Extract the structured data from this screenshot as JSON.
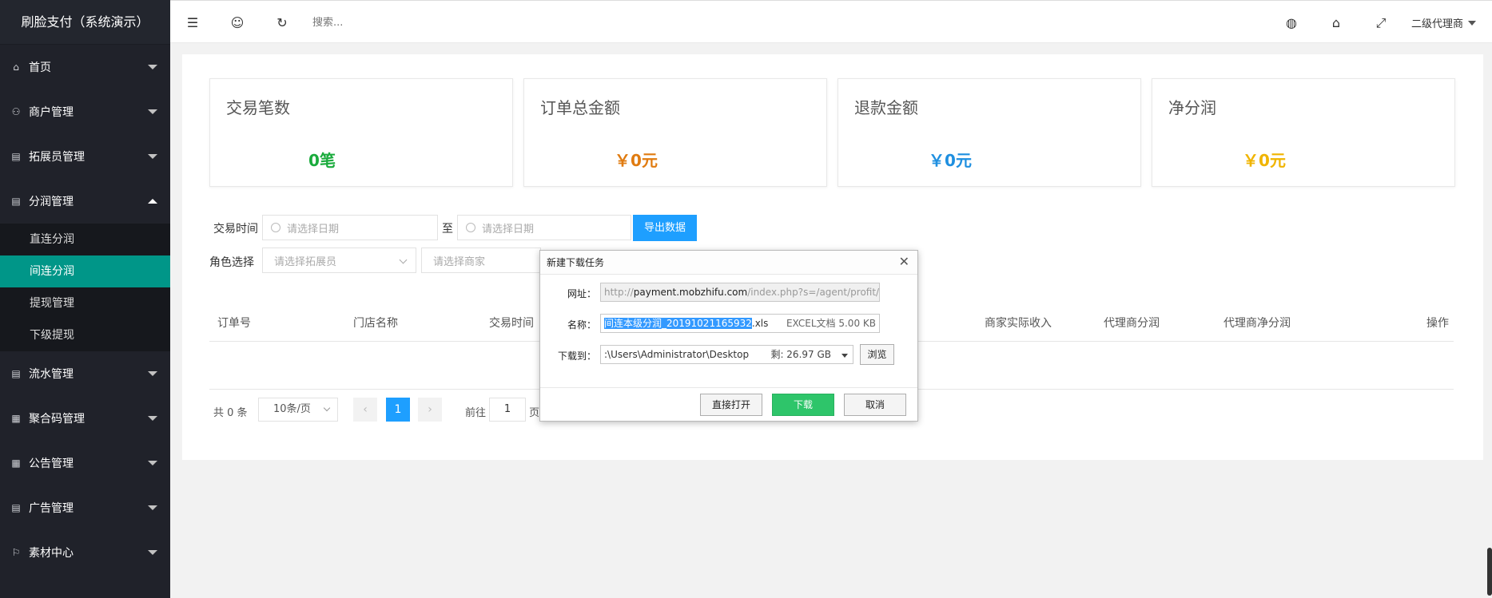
{
  "app_title": "刷脸支付（系统演示）",
  "sidebar": {
    "items": [
      {
        "label": "首页",
        "icon": "home-icon"
      },
      {
        "label": "商户管理",
        "icon": "user-icon"
      },
      {
        "label": "拓展员管理",
        "icon": "clipboard-icon"
      },
      {
        "label": "分润管理",
        "icon": "clipboard-icon",
        "expanded": true,
        "children": [
          "直连分润",
          "间连分润",
          "提现管理",
          "下级提现"
        ],
        "active_child": "间连分润"
      },
      {
        "label": "流水管理",
        "icon": "clipboard-icon"
      },
      {
        "label": "聚合码管理",
        "icon": "grid-icon"
      },
      {
        "label": "公告管理",
        "icon": "grid-icon"
      },
      {
        "label": "广告管理",
        "icon": "clipboard-icon"
      },
      {
        "label": "素材中心",
        "icon": "flag-icon"
      }
    ]
  },
  "header": {
    "search_placeholder": "搜索...",
    "user_label": "二级代理商"
  },
  "stats": [
    {
      "title": "交易笔数",
      "value": "0笔",
      "color": "#1aab3c"
    },
    {
      "title": "订单总金额",
      "value": "￥0元",
      "color": "#e07b10"
    },
    {
      "title": "退款金额",
      "value": "￥0元",
      "color": "#1e8fe0"
    },
    {
      "title": "净分润",
      "value": "￥0元",
      "color": "#f0b400"
    }
  ],
  "filters": {
    "time_label": "交易时间",
    "date_placeholder": "请选择日期",
    "to_label": "至",
    "export_label": "导出数据",
    "role_label": "角色选择",
    "expander_placeholder": "请选择拓展员",
    "merchant_placeholder": "请选择商家"
  },
  "table": {
    "columns": [
      "订单号",
      "门店名称",
      "交易时间",
      "商家实际收入",
      "代理商分润",
      "代理商净分润",
      "操作"
    ]
  },
  "pager": {
    "total": "共 0 条",
    "per_page": "10条/页",
    "current": "1",
    "goto_label": "前往",
    "goto_value": "1",
    "page_suffix": "页"
  },
  "dialog": {
    "title": "新建下载任务",
    "url_label": "网址：",
    "url_prefix": "http://",
    "url_domain": "payment.mobzhifu.com",
    "url_path": "/index.php?s=/agent/profit/in",
    "name_label": "名称：",
    "name_selected": "间连本级分润_20191021165932",
    "name_ext": ".xls",
    "file_meta": "EXCEL文档 5.00 KB",
    "path_label": "下载到：",
    "path_value": ":\\Users\\Administrator\\Desktop",
    "free_space": "剩: 26.97 GB",
    "browse": "浏览",
    "open_direct": "直接打开",
    "download": "下载",
    "cancel": "取消"
  }
}
